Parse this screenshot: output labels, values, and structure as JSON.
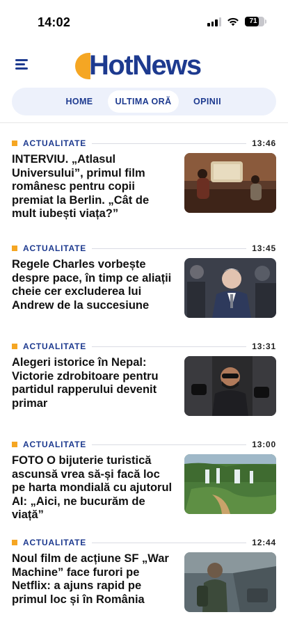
{
  "status_bar": {
    "time": "14:02",
    "battery": "71"
  },
  "header": {
    "logo_text": "HotNews",
    "menu_icon": "hamburger-menu-icon"
  },
  "tabs": [
    {
      "label": "HOME"
    },
    {
      "label": "ULTIMA ORĂ",
      "active": true
    },
    {
      "label": "OPINII"
    }
  ],
  "articles": [
    {
      "category": "ACTUALITATE",
      "time": "13:46",
      "headline": "INTERVIU. „Atlasul Universului”, primul film românesc pentru copii premiat la Berlin. „Cât de mult iubești viața?”"
    },
    {
      "category": "ACTUALITATE",
      "time": "13:45",
      "headline": "Regele Charles vorbește despre pace, în timp ce aliații cheie cer excluderea lui Andrew de la succesiune"
    },
    {
      "category": "ACTUALITATE",
      "time": "13:31",
      "headline": "Alegeri istorice în Nepal: Victorie zdrobitoare pentru partidul rapperului devenit primar"
    },
    {
      "category": "ACTUALITATE",
      "time": "13:00",
      "headline": "FOTO O bijuterie turistică ascunsă vrea să-și facă loc pe harta mondială cu ajutorul AI: „Aici, ne bucurăm de viață”"
    },
    {
      "category": "ACTUALITATE",
      "time": "12:44",
      "headline": "Noul film de acțiune SF „War Machine” face furori pe Netflix: a ajuns rapid pe primul loc și în România"
    }
  ],
  "colors": {
    "brand_blue": "#1d3a8f",
    "accent_orange": "#f5a623",
    "tab_bg": "#edf1fb"
  }
}
